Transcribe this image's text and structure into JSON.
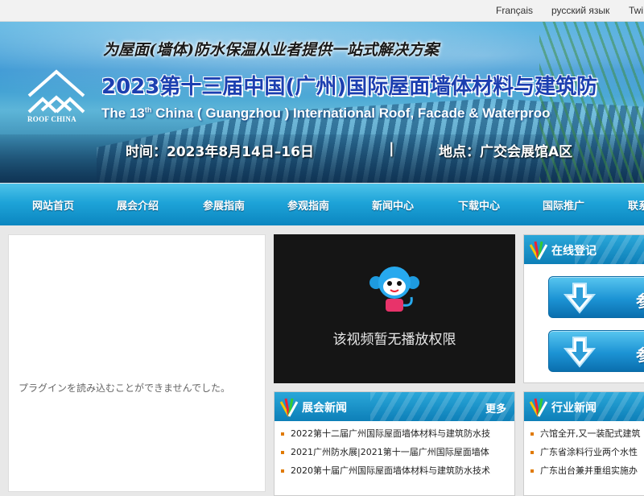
{
  "top_bar": {
    "languages": [
      "Français",
      "русский язык",
      "Twi"
    ]
  },
  "banner": {
    "slogan": "为屋面(墙体)防水保温从业者提供一站式解决方案",
    "title_cn": "2023第十三届中国(广州)国际屋面墙体材料与建筑防",
    "title_en_prefix": "The 13",
    "title_en_sup": "th",
    "title_en_rest": " China ( Guangzhou ) International Roof, Facade & Waterproo",
    "date": "时间：2023年8月14日–16日",
    "separator": "|",
    "venue": "地点：广交会展馆A区",
    "logo_text": "ROOF CHINA"
  },
  "nav": {
    "items": [
      "网站首页",
      "展会介绍",
      "参展指南",
      "参观指南",
      "新闻中心",
      "下载中心",
      "国际推广",
      "联系"
    ]
  },
  "plugin_panel": {
    "message": "プラグインを読み込むことができませんでした。"
  },
  "video": {
    "message": "该视频暂无播放权限"
  },
  "online_register": {
    "title": "在线登记",
    "buttons": [
      "参",
      "参"
    ]
  },
  "expo_news": {
    "title": "展会新闻",
    "more": "更多",
    "items": [
      "2022第十二届广州国际屋面墙体材料与建筑防水技",
      "2021广州防水展|2021第十一届广州国际屋面墙体",
      "2020第十届广州国际屋面墙体材料与建筑防水技术"
    ]
  },
  "industry_news": {
    "title": "行业新闻",
    "items": [
      "六馆全开,又一装配式建筑",
      "广东省涂料行业两个水性",
      "广东出台兼并重组实施办"
    ]
  },
  "colors": {
    "nav_blue": "#1ea3d8",
    "accent_orange": "#e07a00"
  }
}
